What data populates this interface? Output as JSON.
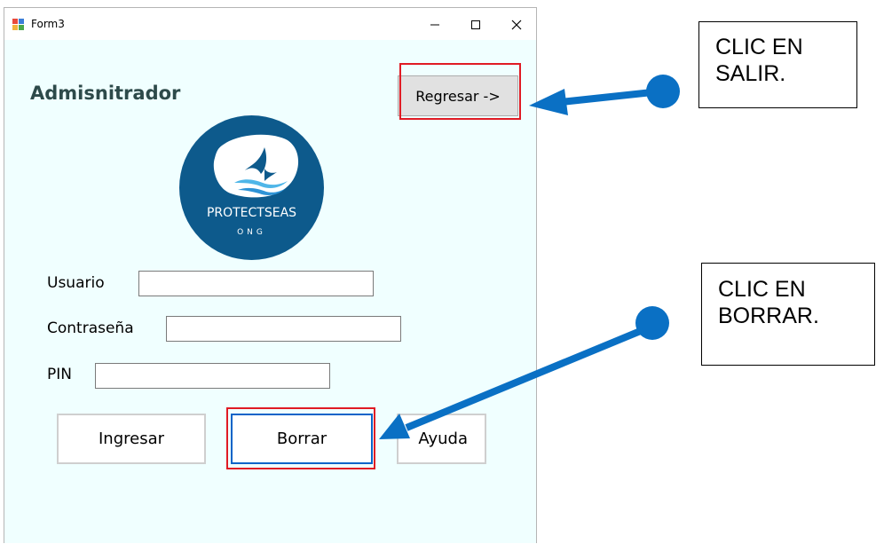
{
  "window": {
    "title": "Form3",
    "controls": {
      "minimize_icon": "minimize-icon",
      "maximize_icon": "maximize-icon",
      "close_icon": "close-icon"
    }
  },
  "form": {
    "heading": "Admisnitrador",
    "back_button": "Regresar ->",
    "logo": {
      "name": "PROTECTSEAS",
      "sub": "ONG"
    },
    "fields": {
      "user": {
        "label": "Usuario",
        "value": ""
      },
      "password": {
        "label": "Contraseña",
        "value": ""
      },
      "pin": {
        "label": "PIN",
        "value": ""
      }
    },
    "buttons": {
      "login": "Ingresar",
      "clear": "Borrar",
      "help": "Ayuda"
    }
  },
  "annotations": {
    "exit_note": [
      "CLIC EN",
      "SALIR."
    ],
    "clear_note": [
      "CLIC EN",
      "BORRAR."
    ]
  },
  "colors": {
    "form_bg": "#f0ffff",
    "highlight": "#e01b24",
    "arrow": "#0a70c4",
    "logo_bg": "#0d5a8c"
  }
}
